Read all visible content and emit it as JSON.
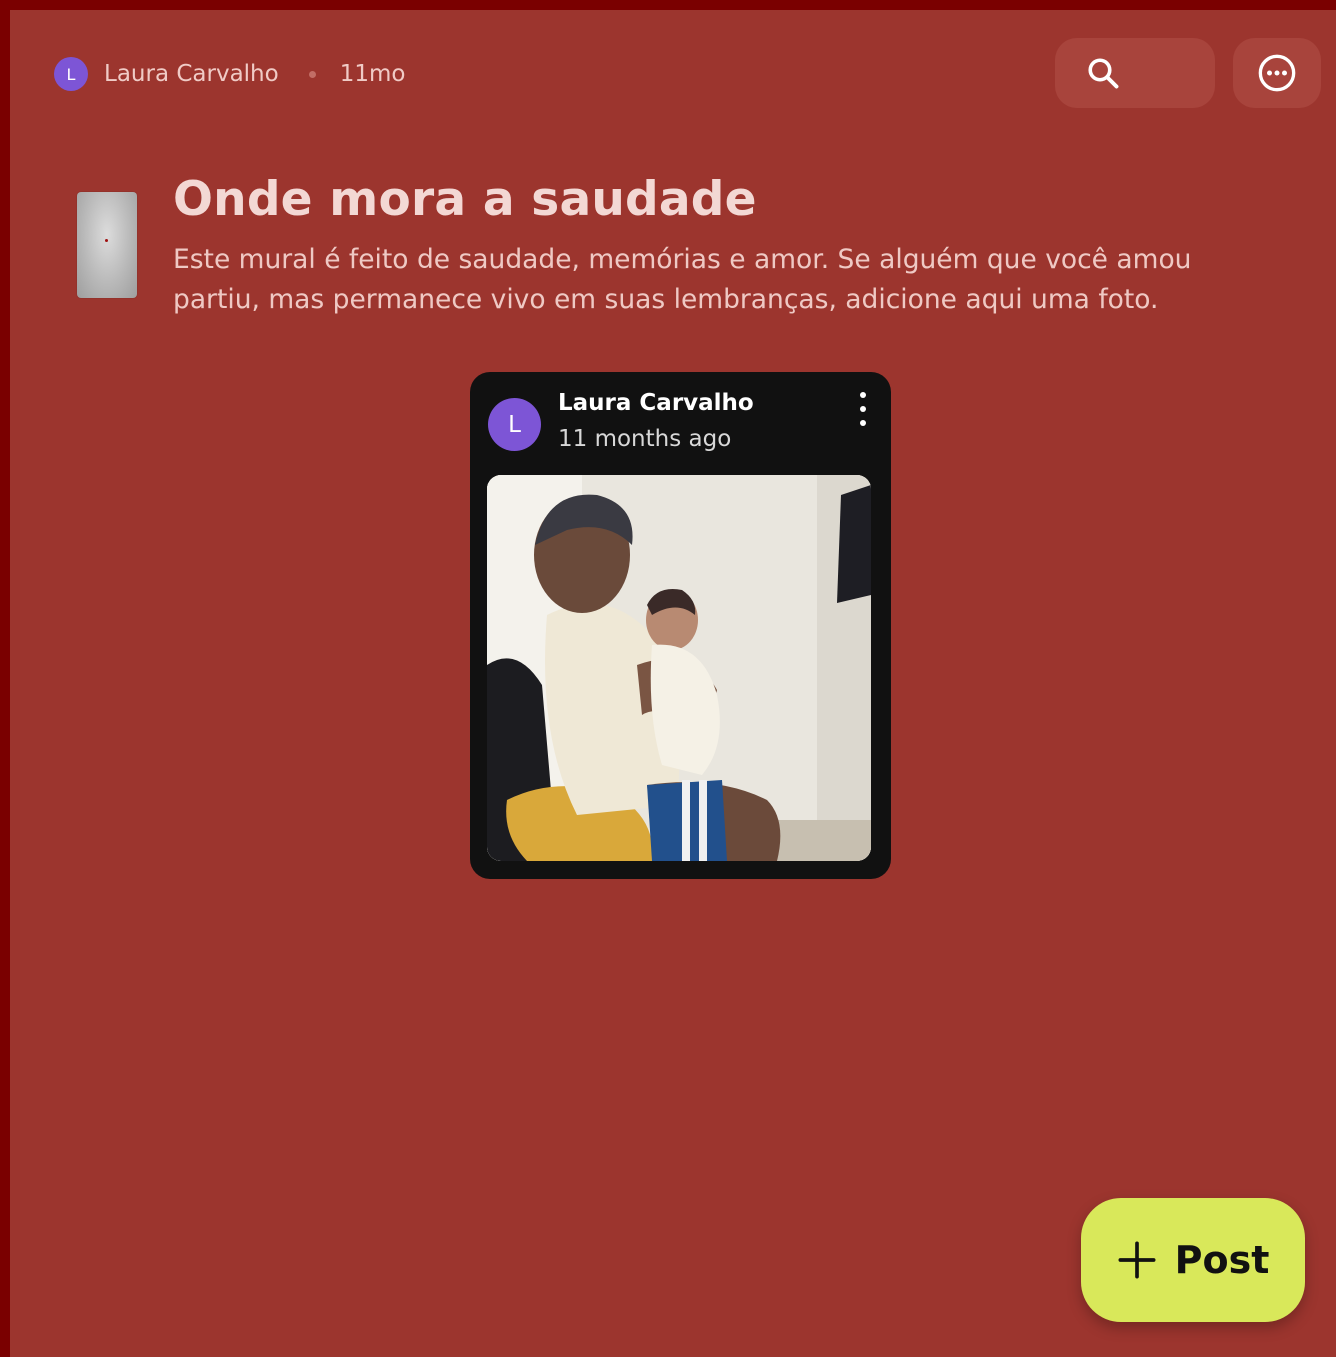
{
  "topbar": {
    "author_initial": "L",
    "author_name": "Laura Carvalho",
    "time": "11mo",
    "search_icon": "search-icon",
    "more_icon": "more-horizontal-circle-icon"
  },
  "wall": {
    "title": "Onde mora a saudade",
    "description": "Este mural é feito de saudade, memórias e amor. Se alguém que você amou partiu, mas permanece vivo em suas lembranças, adicione aqui uma foto."
  },
  "post": {
    "author_initial": "L",
    "author_name": "Laura Carvalho",
    "time": "11 months ago",
    "menu_icon": "kebab-menu-icon"
  },
  "fab": {
    "icon": "plus-icon",
    "label": "Post"
  },
  "colors": {
    "background": "#9c352e",
    "border": "#7a0000",
    "avatar": "#7d55d6",
    "fab": "#d9e85a",
    "card": "#111111"
  }
}
